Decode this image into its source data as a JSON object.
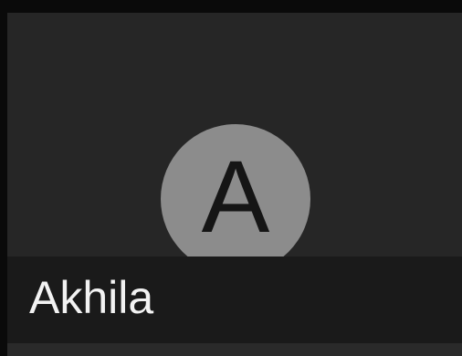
{
  "participant": {
    "initial": "A",
    "name": "Akhila"
  },
  "colors": {
    "background": "#0a0a0a",
    "tile": "#262626",
    "avatar": "#8c8c8c",
    "initial": "#151515",
    "name_bar": "#1a1a1a",
    "name_text": "#f2f2f2"
  }
}
